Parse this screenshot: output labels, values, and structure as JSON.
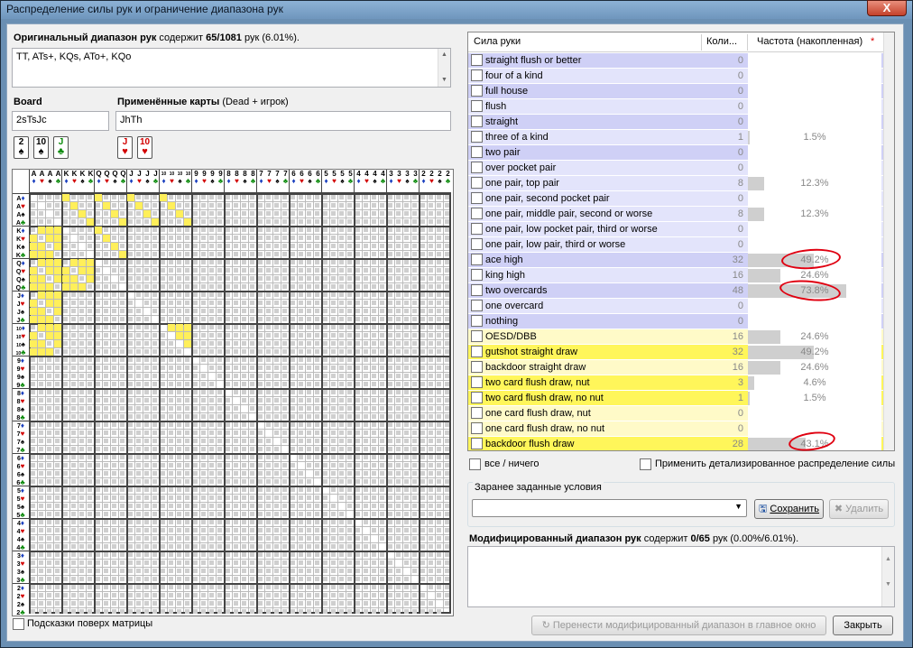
{
  "window": {
    "title": "Распределение силы рук и ограничение диапазона рук",
    "close_label": "X"
  },
  "original_range": {
    "label_bold": "Оригинальный диапазон рук",
    "label_contains": "содержит",
    "count": "65/1081",
    "label_suffix": "рук (6.01%).",
    "value": "TT, ATs+, KQs, ATo+, KQo"
  },
  "board": {
    "label": "Board",
    "value": "2sTsJc",
    "cards": [
      {
        "rank": "2",
        "suit": "♠",
        "color": "blk"
      },
      {
        "rank": "10",
        "suit": "♠",
        "color": "blk"
      },
      {
        "rank": "J",
        "suit": "♣",
        "color": "grn"
      }
    ]
  },
  "dead": {
    "label_bold": "Применённые карты",
    "label_rest": "(Dead + игрок)",
    "value": "JhTh",
    "cards": [
      {
        "rank": "J",
        "suit": "♥",
        "color": "red"
      },
      {
        "rank": "10",
        "suit": "♥",
        "color": "red"
      }
    ]
  },
  "matrix": {
    "ranks": [
      "A",
      "K",
      "Q",
      "J",
      "10",
      "9",
      "8",
      "7",
      "6",
      "5",
      "4",
      "3",
      "2"
    ],
    "suits": [
      {
        "sym": "♦",
        "color": "blu"
      },
      {
        "sym": "♥",
        "color": "red"
      },
      {
        "sym": "♠",
        "color": "blk"
      },
      {
        "sym": "♣",
        "color": "grn"
      }
    ],
    "overlay_label": "Подсказки поверх матрицы"
  },
  "table": {
    "col_strength": "Сила руки",
    "col_count": "Коли...",
    "col_freq": "Частота (накопленная)",
    "rows": [
      {
        "name": "straight flush or better",
        "count": "0",
        "pct": "",
        "bar": 0,
        "bg": "#cfd0f6"
      },
      {
        "name": "four of a kind",
        "count": "0",
        "pct": "",
        "bar": 0,
        "bg": "#e3e4fb"
      },
      {
        "name": "full house",
        "count": "0",
        "pct": "",
        "bar": 0,
        "bg": "#cfd0f6"
      },
      {
        "name": "flush",
        "count": "0",
        "pct": "",
        "bar": 0,
        "bg": "#e3e4fb"
      },
      {
        "name": "straight",
        "count": "0",
        "pct": "",
        "bar": 0,
        "bg": "#cfd0f6"
      },
      {
        "name": "three of a kind",
        "count": "1",
        "pct": "1.5%",
        "bar": 0.015,
        "bg": "#e3e4fb"
      },
      {
        "name": "two pair",
        "count": "0",
        "pct": "",
        "bar": 0,
        "bg": "#cfd0f6"
      },
      {
        "name": "over pocket pair",
        "count": "0",
        "pct": "",
        "bar": 0,
        "bg": "#e3e4fb"
      },
      {
        "name": "one pair, top pair",
        "count": "8",
        "pct": "12.3%",
        "bar": 0.123,
        "bg": "#e3e4fb"
      },
      {
        "name": "one pair, second pocket pair",
        "count": "0",
        "pct": "",
        "bar": 0,
        "bg": "#e3e4fb"
      },
      {
        "name": "one pair, middle pair, second or worse",
        "count": "8",
        "pct": "12.3%",
        "bar": 0.123,
        "bg": "#e3e4fb"
      },
      {
        "name": "one pair, low pocket pair, third or worse",
        "count": "0",
        "pct": "",
        "bar": 0,
        "bg": "#e3e4fb"
      },
      {
        "name": "one pair, low pair, third or worse",
        "count": "0",
        "pct": "",
        "bar": 0,
        "bg": "#e3e4fb"
      },
      {
        "name": "ace high",
        "count": "32",
        "pct": "49.2%",
        "bar": 0.492,
        "bg": "#cfd0f6"
      },
      {
        "name": "king high",
        "count": "16",
        "pct": "24.6%",
        "bar": 0.246,
        "bg": "#e3e4fb"
      },
      {
        "name": "two overcards",
        "count": "48",
        "pct": "73.8%",
        "bar": 0.738,
        "bg": "#cfd0f6"
      },
      {
        "name": "one overcard",
        "count": "0",
        "pct": "",
        "bar": 0,
        "bg": "#e3e4fb"
      },
      {
        "name": "nothing",
        "count": "0",
        "pct": "",
        "bar": 0,
        "bg": "#cfd0f6"
      },
      {
        "name": "OESD/DBB",
        "count": "16",
        "pct": "24.6%",
        "bar": 0.246,
        "bg": "#fffac8"
      },
      {
        "name": "gutshot straight draw",
        "count": "32",
        "pct": "49.2%",
        "bar": 0.492,
        "bg": "#fff65a"
      },
      {
        "name": "backdoor straight draw",
        "count": "16",
        "pct": "24.6%",
        "bar": 0.246,
        "bg": "#fffac8"
      },
      {
        "name": "two card flush draw, nut",
        "count": "3",
        "pct": "4.6%",
        "bar": 0.046,
        "bg": "#fff65a"
      },
      {
        "name": "two card flush draw, no nut",
        "count": "1",
        "pct": "1.5%",
        "bar": 0.015,
        "bg": "#fff65a"
      },
      {
        "name": "one card flush draw, nut",
        "count": "0",
        "pct": "",
        "bar": 0,
        "bg": "#fffac8"
      },
      {
        "name": "one card flush draw, no nut",
        "count": "0",
        "pct": "",
        "bar": 0,
        "bg": "#fffac8"
      },
      {
        "name": "backdoor flush draw",
        "count": "28",
        "pct": "43.1%",
        "bar": 0.431,
        "bg": "#fff65a"
      }
    ]
  },
  "options": {
    "all_none": "все / ничего",
    "detailed": "Применить детализированное распределение силы"
  },
  "presets": {
    "label": "Заранее заданные условия",
    "selected": "",
    "save": "Сохранить",
    "delete": "Удалить"
  },
  "modified_range": {
    "label_bold": "Модифицированный диапазон рук",
    "label_contains": "содержит",
    "count": "0/65",
    "label_suffix": "рук (0.00%/6.01%).",
    "value": ""
  },
  "buttons": {
    "transfer": "Перенести модифицированный диапазон в главное окно",
    "close": "Закрыть"
  },
  "colors": {
    "strength_blue_dark": "#cfd0f6",
    "strength_blue_light": "#e3e4fb",
    "draw_yellow": "#fff65a",
    "draw_yellow_light": "#fffac8",
    "matrix_highlight": "#ffef5a",
    "annotation_red": "#e00010"
  }
}
